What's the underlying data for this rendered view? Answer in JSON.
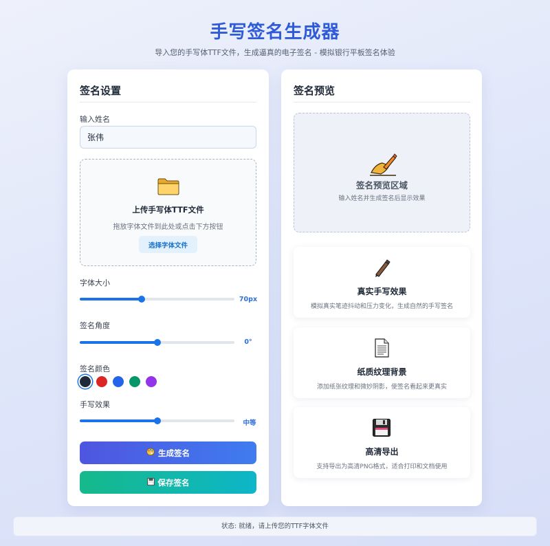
{
  "header": {
    "title": "手写签名生成器",
    "subtitle": "导入您的手写体TTF文件，生成逼真的电子签名 - 模拟银行平板签名体验"
  },
  "settings": {
    "title": "签名设置",
    "name_label": "输入姓名",
    "name_value": "张伟",
    "upload": {
      "title": "上传手写体TTF文件",
      "hint": "拖放字体文件到此处或点击下方按钮",
      "button_label": "选择字体文件",
      "icon": "folder-icon"
    },
    "font_size": {
      "label": "字体大小",
      "value_text": "70px",
      "fraction": 0.4
    },
    "angle": {
      "label": "签名角度",
      "value_text": "0°",
      "fraction": 0.5
    },
    "color": {
      "label": "签名颜色",
      "swatches": [
        "#1f2937",
        "#dc2626",
        "#2563eb",
        "#059669",
        "#9333ea"
      ],
      "selected_index": 0
    },
    "effect": {
      "label": "手写效果",
      "value_text": "中等",
      "fraction": 0.5
    },
    "generate_label": "生成签名",
    "save_label": "保存签名",
    "generate_icon": "palette-icon",
    "save_icon": "floppy-disk-icon"
  },
  "preview": {
    "title": "签名预览",
    "area_title": "签名预览区域",
    "area_hint": "输入姓名并生成签名后显示效果",
    "area_icon": "hand-writing-icon",
    "features": [
      {
        "icon": "pen-icon",
        "title": "真实手写效果",
        "desc": "模拟真实笔迹抖动和压力变化，生成自然的手写签名"
      },
      {
        "icon": "document-icon",
        "title": "纸质纹理背景",
        "desc": "添加纸张纹理和微妙阴影，使签名看起来更真实"
      },
      {
        "icon": "floppy-disk-icon",
        "title": "高清导出",
        "desc": "支持导出为高清PNG格式，适合打印和文档使用"
      }
    ]
  },
  "status": {
    "text": "状态: 就绪，请上传您的TTF字体文件"
  },
  "colors": {
    "accent": "#1a73e8",
    "title": "#2f5bd8"
  }
}
